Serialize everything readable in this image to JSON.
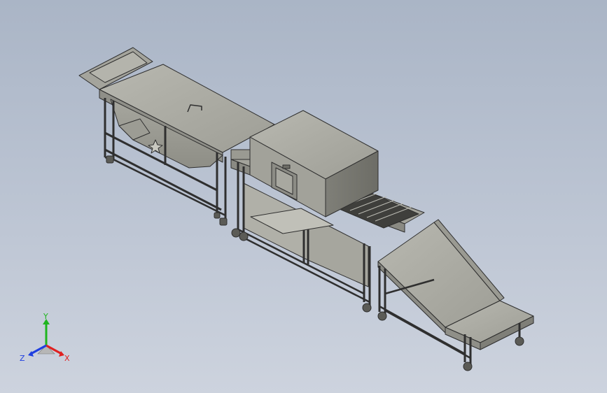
{
  "view": {
    "model": "conveyor-assembly",
    "background_top": "#aab5c6",
    "background_bottom": "#cdd3de",
    "body_color": "#a9a9a0",
    "frame_color": "#9a9a92",
    "edge_color": "#2f2f2f"
  },
  "triad": {
    "x_label": "X",
    "y_label": "Y",
    "z_label": "Z",
    "x_color": "#e02020",
    "y_color": "#1fb51f",
    "z_color": "#1f3fe0"
  }
}
